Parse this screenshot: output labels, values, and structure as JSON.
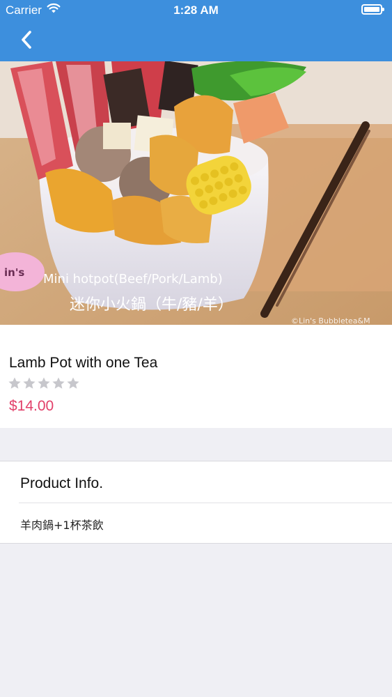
{
  "status_bar": {
    "carrier": "Carrier",
    "time": "1:28 AM"
  },
  "nav": {
    "back_icon": "chevron-left-icon"
  },
  "hero": {
    "caption_en": "Mini hotpot(Beef/Pork/Lamb)",
    "caption_zh": "迷你小火鍋（牛/豬/羊）",
    "badge": "in's",
    "watermark": "©Lin's Bubbletea&M"
  },
  "product": {
    "name": "Lamb Pot with one Tea",
    "rating": 0,
    "rating_max": 5,
    "price": "$14.00"
  },
  "info": {
    "title": "Product Info.",
    "description": "羊肉鍋+1杯茶飲"
  },
  "colors": {
    "nav_blue": "#3d8fdd",
    "price": "#e2406a",
    "star_empty": "#c7c7cc",
    "background": "#efeff4"
  }
}
